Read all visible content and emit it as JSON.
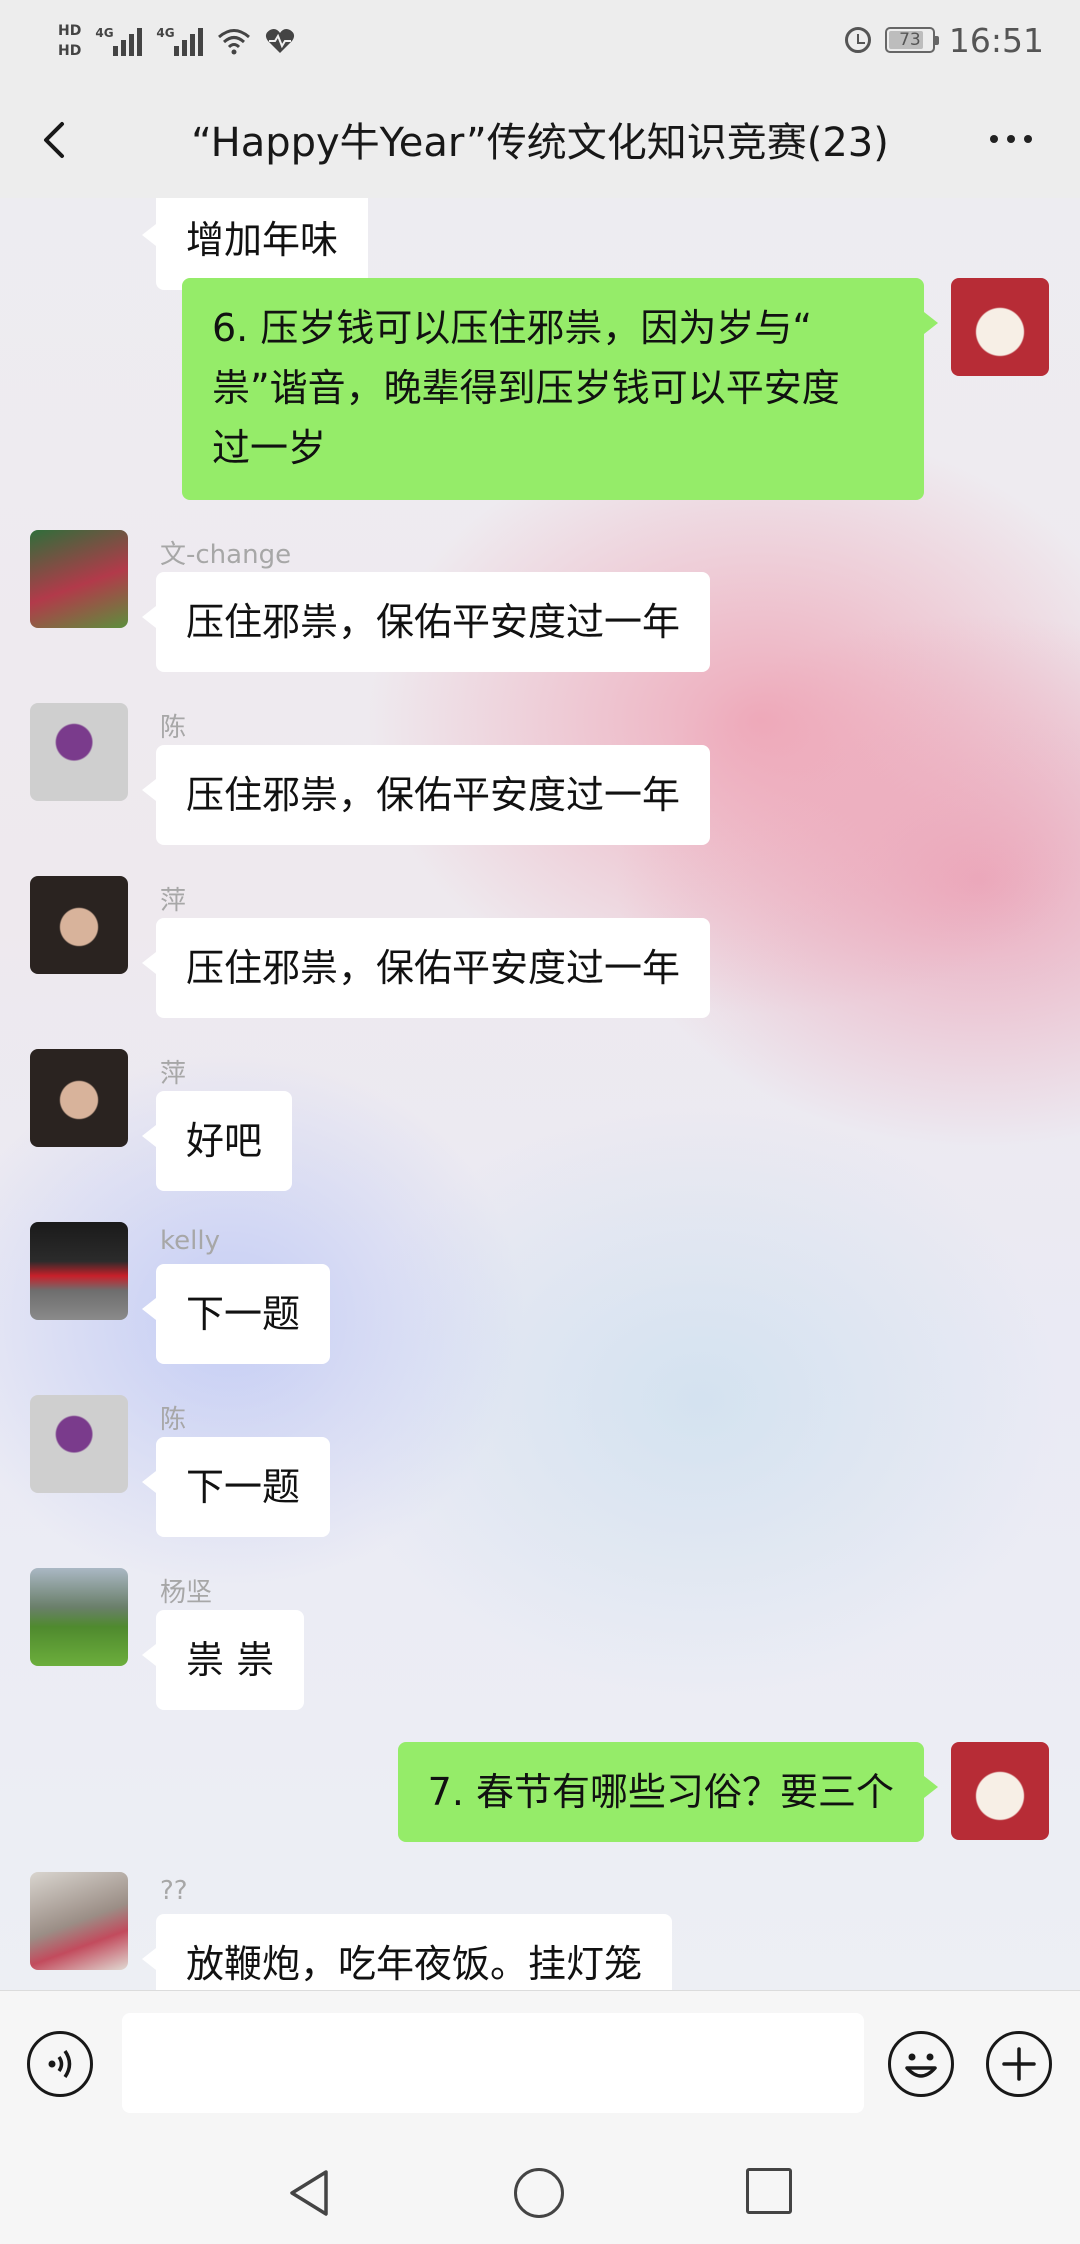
{
  "status_bar": {
    "hd1": "HD",
    "hd2": "HD",
    "net1": "4G",
    "net2": "4G",
    "battery": "73",
    "time": "16:51"
  },
  "header": {
    "title": "“Happy牛Year”传统文化知识竞赛(23)"
  },
  "messages": [
    {
      "side": "in",
      "name": "",
      "text": "增加年味"
    },
    {
      "side": "out",
      "name": "",
      "lines": [
        "6. 压岁钱可以压住邪祟，因为岁与“",
        "祟”谐音，晚辈得到压岁钱可以平安度",
        "过一岁"
      ]
    },
    {
      "side": "in",
      "name": "文-change",
      "text": "压住邪祟，保佑平安度过一年"
    },
    {
      "side": "in",
      "name": "陈",
      "text": "压住邪祟，保佑平安度过一年"
    },
    {
      "side": "in",
      "name": "萍",
      "text": "压住邪祟，保佑平安度过一年"
    },
    {
      "side": "in",
      "name": "萍",
      "text": "好吧"
    },
    {
      "side": "in",
      "name": "kelly",
      "text": "下一题"
    },
    {
      "side": "in",
      "name": "陈",
      "text": "下一题"
    },
    {
      "side": "in",
      "name": "杨坚",
      "text": "祟 祟"
    },
    {
      "side": "out",
      "name": "",
      "text": "7. 春节有哪些习俗？要三个"
    },
    {
      "side": "in",
      "name": "??",
      "text": "放鞭炮，吃年夜饭。挂灯笼"
    }
  ],
  "input": {
    "value": "",
    "placeholder": ""
  },
  "colors": {
    "outgoing_bubble": "#95ec69",
    "incoming_bubble": "#ffffff",
    "nav_bg": "#ededed"
  }
}
